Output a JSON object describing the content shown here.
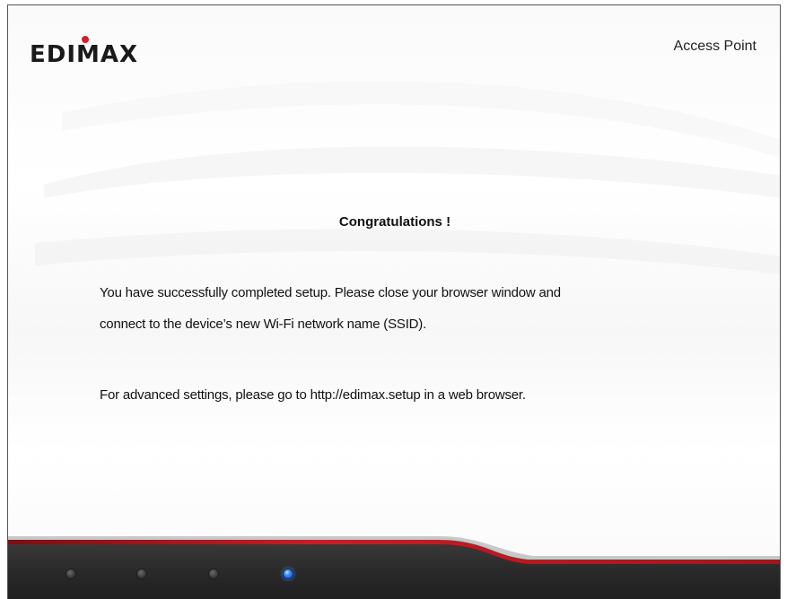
{
  "header": {
    "brand": "EDIMAX",
    "product_label": "Access Point"
  },
  "main": {
    "title": "Congratulations !",
    "message_line1": "You have successfully completed setup. Please close your browser window and",
    "message_line2": "connect to the device’s new Wi-Fi network name (SSID).",
    "message_line3": "For advanced settings, please go to http://edimax.setup in a web browser."
  },
  "progress": {
    "total_steps": 4,
    "current_step": 4
  },
  "colors": {
    "brand_dark": "#1a1a1a",
    "brand_red": "#d4202a",
    "footer_dark": "#2b2b2b",
    "active_dot": "#2a6cf0"
  }
}
